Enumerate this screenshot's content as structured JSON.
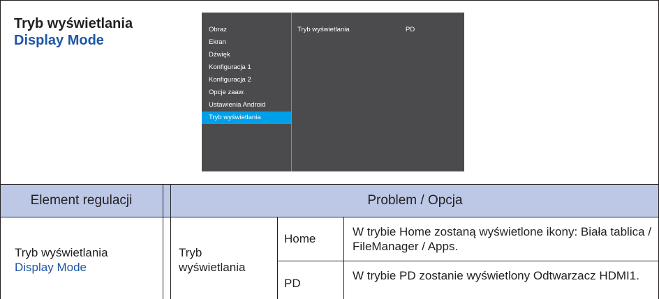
{
  "title": {
    "polish": "Tryb wyświetlania",
    "english": "Display Mode"
  },
  "osd": {
    "menu_items": [
      "Obraz",
      "Ekran",
      "Dźwięk",
      "Konfiguracja 1",
      "Konfiguracja 2",
      "Opcje zaaw.",
      "Ustawienia Android",
      "Tryb wyświetlania"
    ],
    "selected_item": "Tryb wyświetlania",
    "setting_label": "Tryb wyświetlania",
    "setting_value": "PD",
    "colors": {
      "background": "#4b4b4d",
      "highlight": "#00a0e9"
    }
  },
  "table": {
    "headers": {
      "item": "Element regulacji",
      "problem_option": "Problem / Opcja"
    },
    "row": {
      "item_polish": "Tryb wyświetlania",
      "item_english": "Display Mode",
      "setting": "Tryb wyświetlania",
      "options": [
        {
          "name": "Home",
          "description": "W trybie Home zostaną wyświetlone ikony: Biała tablica / FileManager / Apps."
        },
        {
          "name": "PD",
          "description": "W trybie PD zostanie wyświetlony Odtwarzacz HDMI1."
        }
      ]
    }
  }
}
